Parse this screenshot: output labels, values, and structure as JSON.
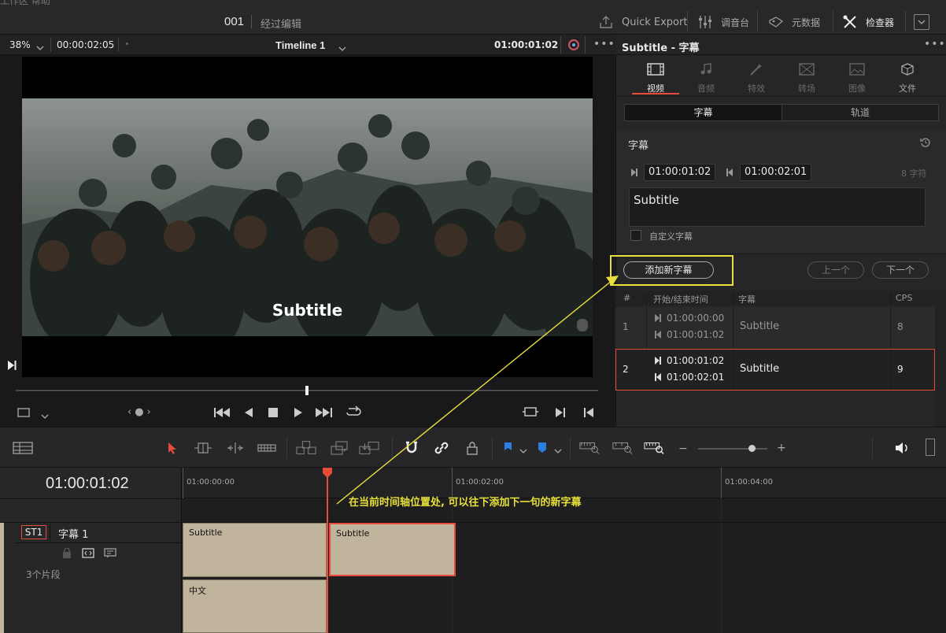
{
  "topbar": {
    "crumb": "工作区  帮助",
    "project_number": "001",
    "project_name": "经过编辑",
    "quick_export": "Quick Export",
    "mixer": "调音台",
    "metadata": "元数据",
    "inspector": "检查器"
  },
  "viewer": {
    "zoom": "38%",
    "duration": "00:00:02:05",
    "timeline_name": "Timeline 1",
    "timecode": "01:00:01:02",
    "subtitle_overlay": "Subtitle",
    "playhead_fraction": 0.5
  },
  "inspector": {
    "title": "Subtitle - 字幕",
    "tabs": [
      {
        "label": "视频",
        "icon": "film-icon"
      },
      {
        "label": "音频",
        "icon": "music-note-icon"
      },
      {
        "label": "特效",
        "icon": "magic-wand-icon"
      },
      {
        "label": "转场",
        "icon": "transition-icon"
      },
      {
        "label": "图像",
        "icon": "image-icon"
      },
      {
        "label": "文件",
        "icon": "file-cube-icon"
      }
    ],
    "subtabs": [
      "字幕",
      "轨道"
    ],
    "section_title": "字幕",
    "in_time": "01:00:01:02",
    "out_time": "01:00:02:01",
    "char_count": "8 字符",
    "text_value": "Subtitle",
    "custom_checkbox_label": "自定义字幕",
    "add_button": "添加新字幕",
    "prev_button": "上一个",
    "next_button": "下一个",
    "table": {
      "headers": [
        "#",
        "开始/结束时间",
        "字幕",
        "CPS"
      ],
      "rows": [
        {
          "num": "1",
          "start": "01:00:00:00",
          "end": "01:00:01:02",
          "text": "Subtitle",
          "cps": "8"
        },
        {
          "num": "2",
          "start": "01:00:01:02",
          "end": "01:00:02:01",
          "text": "Subtitle",
          "cps": "9"
        }
      ]
    }
  },
  "timeline": {
    "timecode": "01:00:01:02",
    "ruler": [
      "01:00:00:00",
      "01:00:02:00",
      "01:00:04:00"
    ],
    "track_id": "ST1",
    "track_name": "字幕 1",
    "clip_count": "3个片段",
    "clips": [
      {
        "label": "Subtitle"
      },
      {
        "label": "Subtitle"
      },
      {
        "label": "中文"
      }
    ],
    "annotation": "在当前时间轴位置处, 可以往下添加下一句的新字幕"
  },
  "colors": {
    "accent_red": "#e64b3c",
    "highlight_yellow": "#e8e03a",
    "clip_fill": "#c0b59c"
  }
}
